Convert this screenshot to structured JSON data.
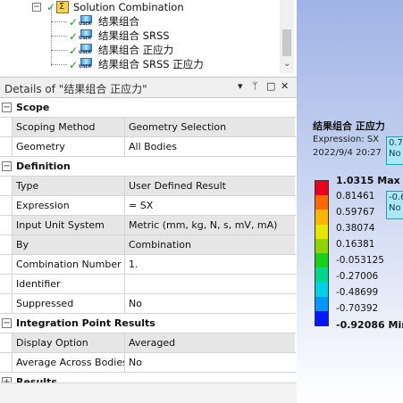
{
  "tree": {
    "solution_label": "Solution Combination",
    "items": [
      {
        "label": "结果组合"
      },
      {
        "label": "结果组合 SRSS"
      },
      {
        "label": "结果组合 正应力"
      },
      {
        "label": "结果组合 SRSS 正应力"
      }
    ],
    "user_icon_text": "USER"
  },
  "details": {
    "title": "Details of \"结果组合 正应力\"",
    "header_buttons": {
      "dropdown": "▾",
      "pin": "ᛘ",
      "maximize": "□",
      "close": "✕"
    },
    "rows": [
      {
        "type": "section",
        "expander": "−",
        "label": "Scope"
      },
      {
        "type": "prop",
        "name": "Scoping Method",
        "value": "Geometry Selection",
        "shaded": true
      },
      {
        "type": "prop",
        "name": "Geometry",
        "value": "All Bodies",
        "shaded": false
      },
      {
        "type": "section",
        "expander": "−",
        "label": "Definition"
      },
      {
        "type": "prop",
        "name": "Type",
        "value": "User Defined Result",
        "shaded": true
      },
      {
        "type": "prop",
        "name": "Expression",
        "value": "= SX",
        "shaded": false
      },
      {
        "type": "prop",
        "name": "Input Unit System",
        "value": "Metric (mm, kg, N, s, mV, mA)",
        "shaded": true
      },
      {
        "type": "prop",
        "name": "By",
        "value": "Combination",
        "shaded": true
      },
      {
        "type": "prop",
        "name": "Combination Number",
        "value": "1.",
        "shaded": false
      },
      {
        "type": "prop",
        "name": "Identifier",
        "value": "",
        "shaded": false
      },
      {
        "type": "prop",
        "name": "Suppressed",
        "value": "No",
        "shaded": false
      },
      {
        "type": "section",
        "expander": "−",
        "label": "Integration Point Results"
      },
      {
        "type": "prop",
        "name": "Display Option",
        "value": "Averaged",
        "shaded": true
      },
      {
        "type": "prop",
        "name": "Average Across Bodies",
        "value": "No",
        "shaded": false
      },
      {
        "type": "section",
        "expander": "+",
        "label": "Results"
      }
    ]
  },
  "legend": {
    "title": "结果组合 正应力",
    "expression": "Expression: SX",
    "date": "2022/9/4 20:27",
    "ticks": [
      {
        "label": "1.0315 Max",
        "bold": true
      },
      {
        "label": "0.81461",
        "bold": false
      },
      {
        "label": "0.59767",
        "bold": false
      },
      {
        "label": "0.38074",
        "bold": false
      },
      {
        "label": "0.16381",
        "bold": false
      },
      {
        "label": "-0.053125",
        "bold": false
      },
      {
        "label": "-0.27006",
        "bold": false
      },
      {
        "label": "-0.48699",
        "bold": false
      },
      {
        "label": "-0.70392",
        "bold": false
      },
      {
        "label": "-0.92086 Min",
        "bold": true
      }
    ],
    "colors": [
      "#e8001c",
      "#ff6a00",
      "#ffb400",
      "#e6e600",
      "#8ed400",
      "#18d018",
      "#00d58e",
      "#00cfe6",
      "#0096ff",
      "#0018ff"
    ],
    "probes": [
      {
        "line1": "0.7",
        "line2": "No"
      },
      {
        "line1": "-0.6",
        "line2": "No"
      }
    ]
  }
}
